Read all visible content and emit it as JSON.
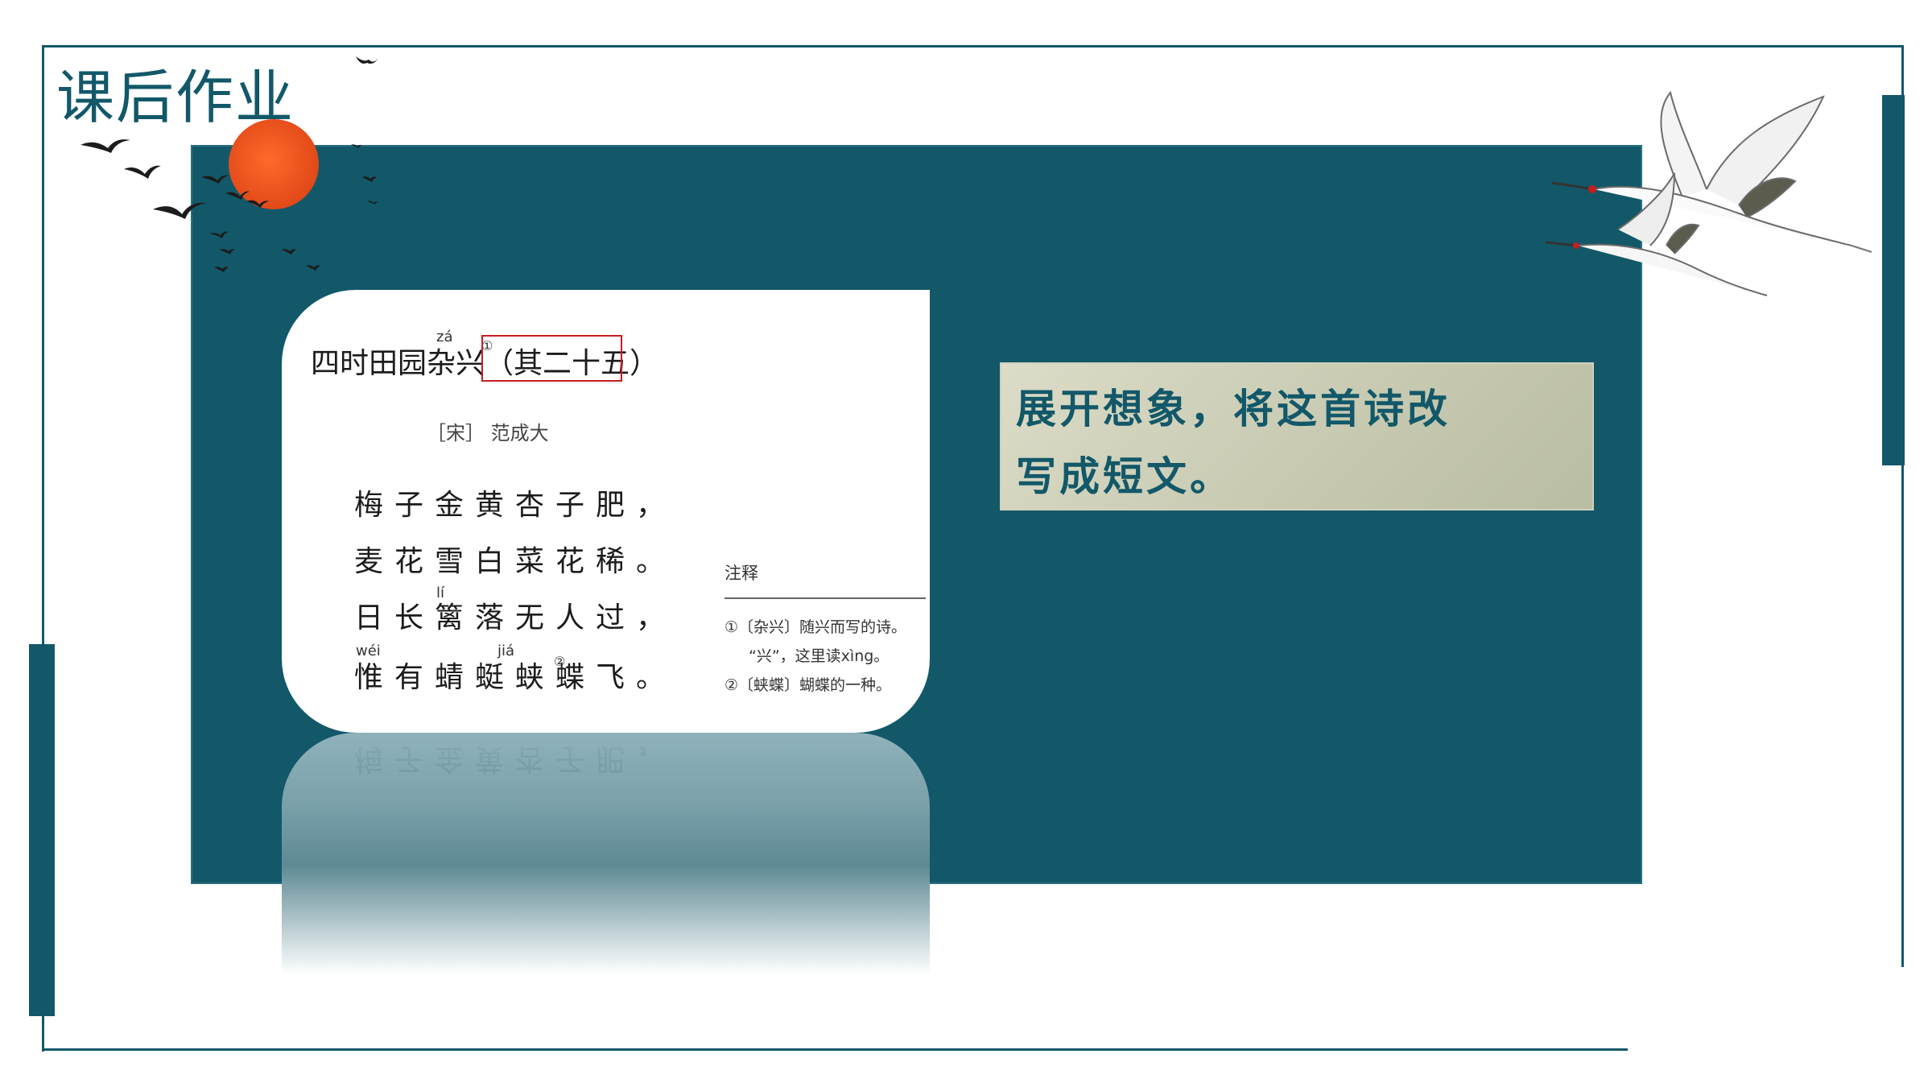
{
  "slide": {
    "title": "课后作业",
    "colors": {
      "accent": "#125869",
      "sun": "#e8501c",
      "task_bg": "#c9cbb3",
      "highlight": "#c81d1d"
    }
  },
  "poem_card": {
    "title_main": "四时田园杂兴",
    "title_sub": "（其二十五）",
    "title_pinyin": "zá",
    "title_note_mark": "①",
    "author": "［宋］ 范成大",
    "lines": [
      "梅子金黄杏子肥，",
      "麦花雪白菜花稀。",
      "日长篱落无人过，",
      "惟有蜻蜓蛱蝶飞。"
    ],
    "line_pinyin": {
      "li": "lí",
      "wei": "wéi",
      "jia": "jiá"
    },
    "line4_note_mark": "②",
    "notes_title": "注释",
    "notes": [
      "①〔杂兴〕随兴而写的诗。",
      "“兴”，这里读xìng。",
      "②〔蛱蝶〕蝴蝶的一种。"
    ]
  },
  "task": {
    "line1": "展开想象，将这首诗改",
    "line2": "写成短文。"
  },
  "decor": {
    "icons": [
      "sun-icon",
      "bird-flock-icon",
      "crane-icon"
    ]
  }
}
